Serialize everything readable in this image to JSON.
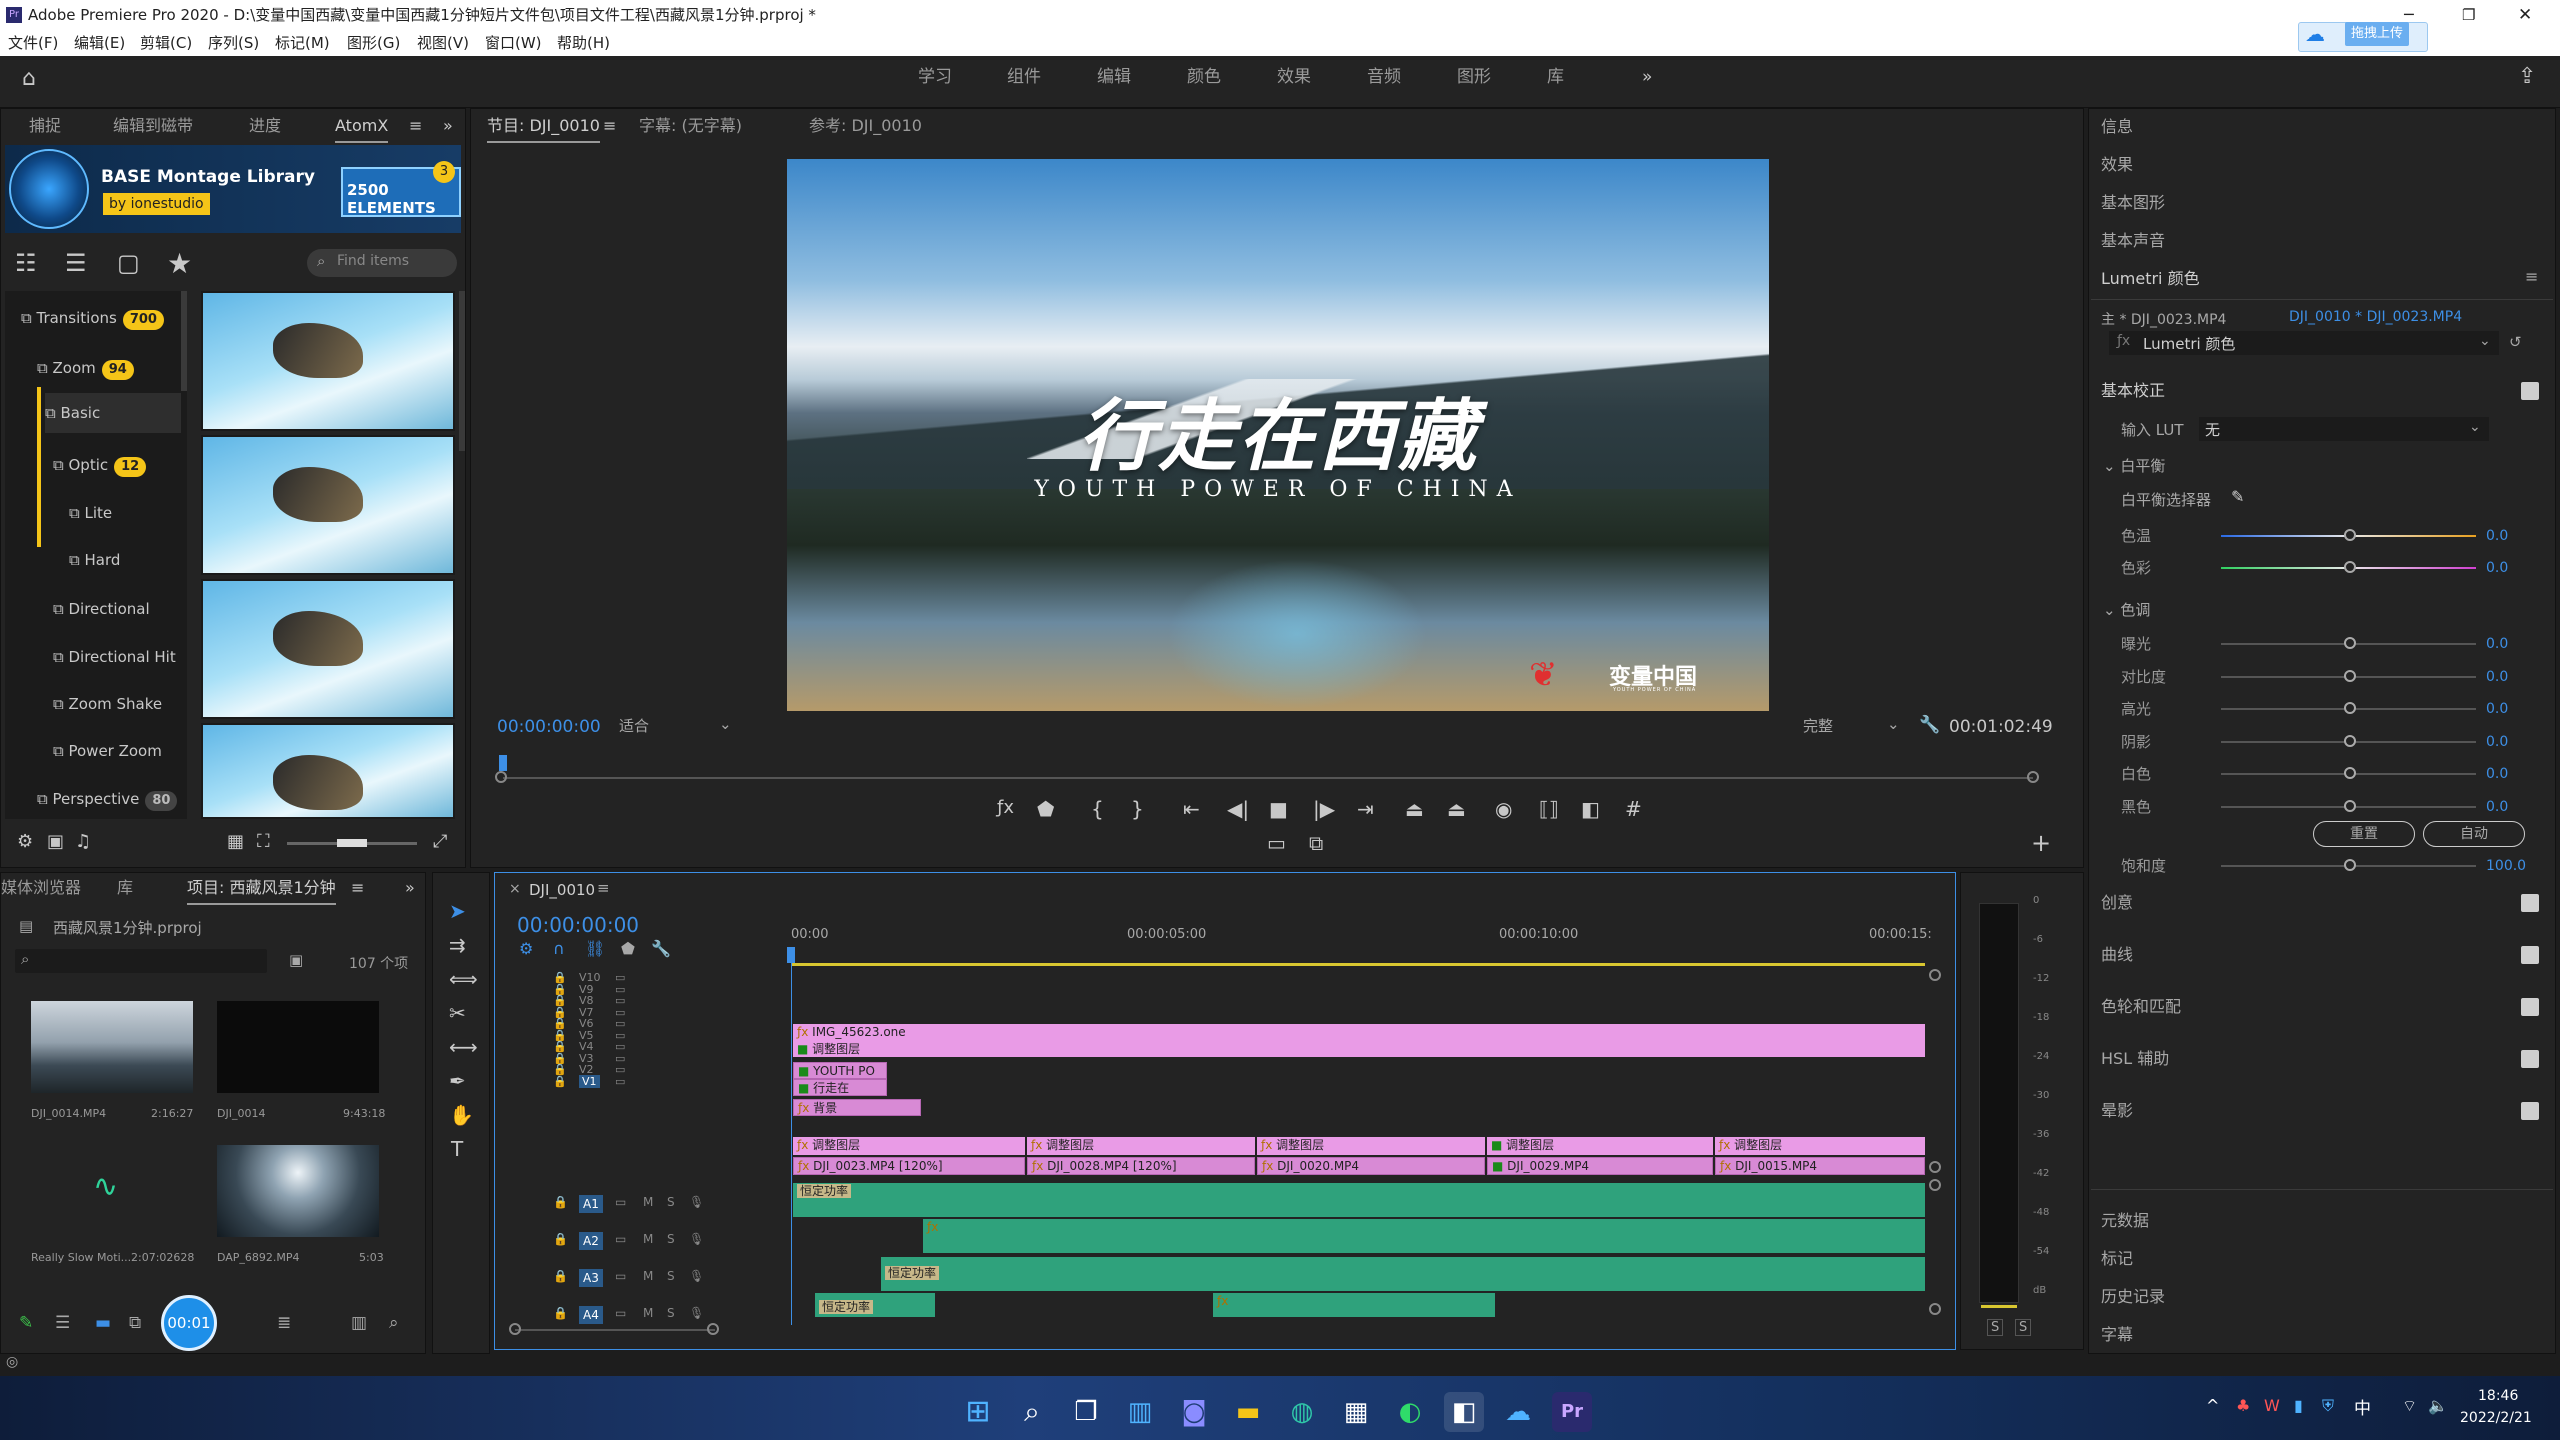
{
  "window": {
    "title": "Adobe Premiere Pro 2020 - D:\\变量中国西藏\\变量中国西藏1分钟短片文件包\\项目文件工程\\西藏风景1分钟.prproj *"
  },
  "menu": [
    "文件(F)",
    "编辑(E)",
    "剪辑(C)",
    "序列(S)",
    "标记(M)",
    "图形(G)",
    "视图(V)",
    "窗口(W)",
    "帮助(H)"
  ],
  "workspaces": [
    "学习",
    "组件",
    "编辑",
    "颜色",
    "效果",
    "音频",
    "图形",
    "库"
  ],
  "upload_label": "拖拽上传",
  "left_tabs": [
    "捕捉",
    "编辑到磁带",
    "进度",
    "AtomX"
  ],
  "library": {
    "name": "BASE Montage Library",
    "by": "by ionestudio",
    "elements": "2500 ELEMENTS",
    "notif": "3",
    "search_placeholder": "Find items"
  },
  "tree": [
    {
      "label": "Transitions",
      "count": "700"
    },
    {
      "label": "Zoom",
      "count": "94"
    },
    {
      "label": "Basic"
    },
    {
      "label": "Optic",
      "count": "12"
    },
    {
      "label": "Lite"
    },
    {
      "label": "Hard"
    },
    {
      "label": "Directional"
    },
    {
      "label": "Directional Hit"
    },
    {
      "label": "Zoom Shake"
    },
    {
      "label": "Power Zoom"
    },
    {
      "label": "Perspective",
      "count": "80"
    }
  ],
  "monitor": {
    "tab_program": "节目: DJI_0010",
    "tab_caption": "字幕: (无字幕)",
    "tab_ref": "参考: DJI_0010",
    "timecode": "00:00:00:00",
    "fit": "适合",
    "quality": "完整",
    "duration": "00:01:02:49",
    "title_cn": "行走在西藏",
    "title_en": "YOUTH POWER OF CHINA",
    "logo": "变量中国",
    "logo_sub": "YOUTH POWER OF CHINA"
  },
  "project": {
    "tabs": [
      "媒体浏览器",
      "库",
      "项目: 西藏风景1分钟"
    ],
    "file": "西藏风景1分钟.prproj",
    "count": "107 个项",
    "items": [
      {
        "name": "DJI_0014.MP4",
        "dur": "2:16:27"
      },
      {
        "name": "DJI_0014",
        "dur": "9:43:18"
      },
      {
        "name": "Really Slow Moti...",
        "dur": "2:07:02628"
      },
      {
        "name": "DAP_6892.MP4",
        "dur": "5:03"
      }
    ],
    "indicator": "00:01"
  },
  "timeline": {
    "tab": "DJI_0010",
    "timecode": "00:00:00:00",
    "ruler": [
      "00:00",
      "00:00:05:00",
      "00:00:10:00",
      "00:00:15:"
    ],
    "video_tracks": [
      "V10",
      "V9",
      "V8",
      "V7",
      "V6",
      "V5",
      "V4",
      "V3",
      "V2",
      "V1"
    ],
    "audio_tracks": [
      "A1",
      "A2",
      "A3",
      "A4"
    ],
    "clips": {
      "img": "IMG_45623.one",
      "adj": "调整图层",
      "youth": "YOUTH PO",
      "walk": "行走在",
      "bg": "背景",
      "v1a": "DJI_0023.MP4 [120%]",
      "v1b": "DJI_0028.MP4 [120%]",
      "v1c": "DJI_0020.MP4",
      "v1d": "DJI_0029.MP4",
      "v1e": "DJI_0015.MP4",
      "const": "恒定功率"
    }
  },
  "meter": {
    "labels": [
      "0",
      "-6",
      "-12",
      "-18",
      "-24",
      "-30",
      "-36",
      "-42",
      "-48",
      "-54",
      "dB"
    ],
    "solo": [
      "S",
      "S"
    ]
  },
  "right_panels": [
    "信息",
    "效果",
    "基本图形",
    "基本声音",
    "Lumetri 颜色"
  ],
  "lumetri": {
    "source": "主 * DJI_0023.MP4",
    "seq": "DJI_0010 * DJI_0023.MP4",
    "effect": "Lumetri 颜色",
    "basic": "基本校正",
    "lut_label": "输入 LUT",
    "lut_value": "无",
    "wb": "白平衡",
    "wb_picker": "白平衡选择器",
    "tone": "色调",
    "wb_rows": [
      {
        "label": "色温",
        "value": "0.0"
      },
      {
        "label": "色彩",
        "value": "0.0"
      }
    ],
    "tone_rows": [
      {
        "label": "曝光",
        "value": "0.0"
      },
      {
        "label": "对比度",
        "value": "0.0"
      },
      {
        "label": "高光",
        "value": "0.0"
      },
      {
        "label": "阴影",
        "value": "0.0"
      },
      {
        "label": "白色",
        "value": "0.0"
      },
      {
        "label": "黑色",
        "value": "0.0"
      }
    ],
    "reset": "重置",
    "auto": "自动",
    "sat_label": "饱和度",
    "sat_value": "100.0",
    "sections": [
      "创意",
      "曲线",
      "色轮和匹配",
      "HSL 辅助",
      "晕影"
    ]
  },
  "right_lower": [
    "元数据",
    "标记",
    "历史记录",
    "字幕"
  ],
  "taskbar": {
    "time": "18:46",
    "date": "2022/2/21",
    "ime": "中"
  },
  "colors": {
    "accent": "#3d8fe6",
    "clip_pink": "#e99be6",
    "audio_green": "#2fa27c",
    "badge": "#f5c518"
  }
}
